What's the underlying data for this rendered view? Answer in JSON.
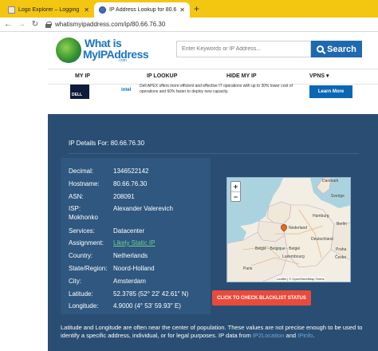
{
  "browser": {
    "tabs": [
      {
        "title": "Logo Explorer – Logging – jmin",
        "active": false
      },
      {
        "title": "IP Address Lookup for 80.66.76.30",
        "active": true
      }
    ],
    "new_tab": "+",
    "url": "whatismyipaddress.com/ip/80.66.76.30"
  },
  "site": {
    "logo_line1": "What is",
    "logo_line2": "MyIPAddress",
    "logo_com": ".com",
    "search_placeholder": "Enter Keywords or IP Address...",
    "search_button": "Search",
    "nav": [
      "MY IP",
      "IP LOOKUP",
      "HIDE MY IP",
      "VPNS ▾"
    ]
  },
  "ad": {
    "brand1": "DELL",
    "brand2": "intel",
    "text": "Dell APEX offers more efficient and effective IT operations with up to 30% lower cost of operations and 60% faster to deploy new capacity.",
    "cta": "Learn More"
  },
  "ip_details": {
    "title": "IP Details For: 80.66.76.30",
    "rows": [
      {
        "label": "Decimal:",
        "value": "1346522142"
      },
      {
        "label": "Hostname:",
        "value": "80.66.76.30"
      },
      {
        "label": "ASN:",
        "value": "208091"
      },
      {
        "label": "ISP:",
        "value": "Alexander Valerevich"
      },
      {
        "label": "",
        "value": "Mokhonko"
      },
      {
        "label": "Services:",
        "value": "Datacenter"
      },
      {
        "label": "Assignment:",
        "value": "Likely Static IP"
      },
      {
        "label": "Country:",
        "value": "Netherlands"
      },
      {
        "label": "State/Region:",
        "value": "Noord-Holland"
      },
      {
        "label": "City:",
        "value": "Amsterdam"
      },
      {
        "label": "Latitude:",
        "value": "52.3785  (52° 22′ 42.61″ N)"
      },
      {
        "label": "Longitude:",
        "value": "4.9000  (4° 53′ 59.93″ E)"
      }
    ],
    "blacklist_button": "CLICK TO CHECK BLACKLIST STATUS"
  },
  "map": {
    "zoom_in": "+",
    "zoom_out": "−",
    "labels": [
      "Danmark",
      "Nederland",
      "België - Belgique - België",
      "Luxembourg",
      "Deutschland",
      "Sverige",
      "Hamburg",
      "Berlin",
      "Praha",
      "Paris",
      "Česko"
    ],
    "attribution": "Leaflet | © OpenStreetMap Terms"
  },
  "disclaimer": {
    "text": "Latitude and Longitude are often near the center of population. These values are not precise enough to be used to identify a specific address, individual, or for legal purposes. IP data from ",
    "link1": "IP2Location",
    "and": " and ",
    "link2": "IPinfo",
    "end": "."
  },
  "colors": {
    "tabstrip": "#f3c612",
    "panel": "#2a4e73",
    "search_button": "#1e6ab0",
    "blacklist_button": "#e84b3c"
  }
}
